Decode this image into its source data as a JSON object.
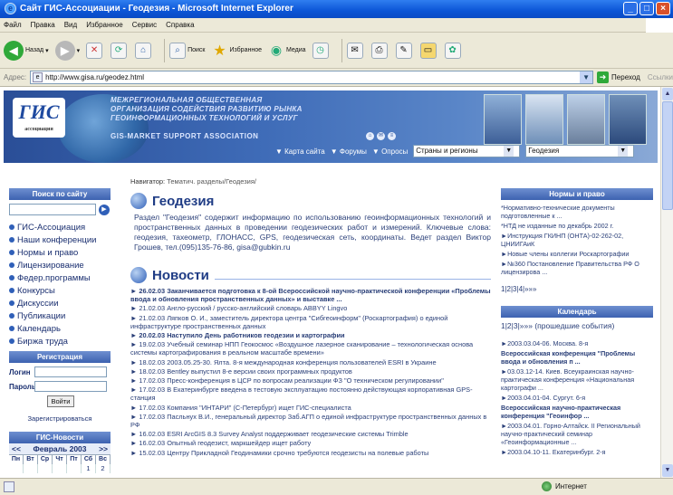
{
  "window": {
    "title": "Сайт ГИС-Ассоциации - Геодезия - Microsoft Internet Explorer"
  },
  "menubar": {
    "items": [
      "Файл",
      "Правка",
      "Вид",
      "Избранное",
      "Сервис",
      "Справка"
    ]
  },
  "toolbar": {
    "back": "Назад",
    "search": "Поиск",
    "favorites": "Избранное",
    "media": "Медиа"
  },
  "address": {
    "label": "Адрес:",
    "url": "http://www.gisa.ru/geodez.html",
    "go": "Переход",
    "links": "Ссылки"
  },
  "banner": {
    "logo": "ГИС",
    "logo_sub": "ассоциация",
    "org_lines": [
      "МЕЖРЕГИОНАЛЬНАЯ ОБЩЕСТВЕННАЯ",
      "ОРГАНИЗАЦИЯ СОДЕЙСТВИЯ РАЗВИТИЮ РЫНКА",
      "ГЕОИНФОРМАЦИОННЫХ ТЕХНОЛОГИЙ И УСЛУГ"
    ],
    "assoc": "GIS-MARKET SUPPORT ASSOCIATION",
    "nav_links": [
      "▼ Карта сайта",
      "▼ Форумы",
      "▼ Опросы"
    ],
    "select1": "Страны и регионы",
    "select2": "Геодезия"
  },
  "left": {
    "search_head": "Поиск по сайту",
    "menu": [
      "ГИС-Ассоциация",
      "Наши конференции",
      "Нормы и право",
      "Лицензирование",
      "Федер.программы",
      "Конкурсы",
      "Дискуссии",
      "Публикации",
      "Календарь",
      "Биржа труда"
    ],
    "reg_head": "Регистрация",
    "login_label": "Логин",
    "password_label": "Пароль",
    "login_button": "Войти",
    "register_link": "Зарегистрироваться",
    "news_head": "ГИС-Новости",
    "cal_prev": "<<",
    "cal_month": "Февраль 2003",
    "cal_next": ">>",
    "cal_days": [
      "Пн",
      "Вт",
      "Ср",
      "Чт",
      "Пт",
      "Сб",
      "Вс"
    ],
    "cal_first_row": [
      "",
      "",
      "",
      "",
      "",
      "1",
      "2"
    ]
  },
  "center": {
    "navigator": "Навигатор:",
    "navigator_path": "Тематич. разделы/Геодезия/",
    "section_title": "Геодезия",
    "intro": "Раздел \"Геодезия\" содержит информацию по использованию геоинформационных технологий и пространственных данных в проведении геодезических работ и измерений. Ключевые слова: геодезия, тахеометр, ГЛОНАСС, GPS, геодезическая сеть, координаты. Ведет раздел Виктор Грошев, тел.(095)135-76-86, gisa@gubkin.ru",
    "news_title": "Новости",
    "news": [
      {
        "text": "► 26.02.03 Заканчивается подготовка к 8-ой Всероссийской научно-практической конференции «Проблемы ввода и обновления пространственных данных» и выставке ...",
        "bold": true
      },
      {
        "text": "► 21.02.03 Англо-русский / русско-английский словарь ABBYY Lingvo",
        "bold": false
      },
      {
        "text": "► 21.02.03 Ляпков О. И., заместитель директора центра \"Сибгеоинформ\" (Роскартография) о единой инфраструктуре пространственных данных",
        "bold": false
      },
      {
        "text": "► 20.02.03 Наступило День работников геодезии и картографии",
        "bold": true
      },
      {
        "text": "► 19.02.03 Учебный семинар НПП Геокосмос «Воздушное лазерное сканирование – технологическая основа системы картографирования в реальном масштабе времени»",
        "bold": false
      },
      {
        "text": "► 18.02.03 2003.05.25-30. Ялта. 8-я международная конференция пользователей ESRI в Украине",
        "bold": false
      },
      {
        "text": "► 18.02.03 Bentley выпустил 8-е версии своих программных продуктов",
        "bold": false
      },
      {
        "text": "► 17.02.03 Пресс-конференция в ЦСР по вопросам реализации ФЗ \"О техническом регулировании\"",
        "bold": false
      },
      {
        "text": "► 17.02.03 В Екатеринбурге введена в тестовую эксплуатацию постоянно действующая корпоративная GPS-станция",
        "bold": false
      },
      {
        "text": "► 17.02.03 Компания \"ИНТАРИ\" (С-Петербург) ищет ГИС-специалиста",
        "bold": false
      },
      {
        "text": "► 17.02.03 Пасльнух В.И., генеральный директор Заб.АГП о единой инфраструктуре пространственных данных в РФ",
        "bold": false
      },
      {
        "text": "► 16.02.03 ESRI ArcGIS 8.3 Survey Analyst поддерживает геодезические системы Trimble",
        "bold": false
      },
      {
        "text": "► 16.02.03 Опытный геодезист, маркшейдер ищет работу",
        "bold": false
      },
      {
        "text": "► 15.02.03 Центру Прикладной Геодинамики срочно требуются геодезисты на полевые работы",
        "bold": false
      }
    ]
  },
  "right": {
    "norms_head": "Нормы и право",
    "norms": [
      {
        "text": "*Нормативно-технические документы подготовленные к ...",
        "bold": false
      },
      {
        "text": "*НТД не изданные по декабрь 2002 г.",
        "bold": false
      },
      {
        "text": "►Инструкция ГКИНП (ОНТА)-02-262-02, ЦНИИГАиК",
        "bold": false
      },
      {
        "text": "►Новые члены коллегии Роскартографии",
        "bold": false
      },
      {
        "text": "►№360 Постановление Правительства РФ О лицензирова ...",
        "bold": false
      }
    ],
    "norms_pager": "1|2|3|4|»»»",
    "cal_head": "Календарь",
    "cal_pager": "1|2|3|»»»   (прошедшие события)",
    "events": [
      {
        "text": "►2003.03.04-06. Москва. 8-я",
        "bold": false
      },
      {
        "text": "Всероссийская конференция \"Проблемы ввода и обновления п ...",
        "bold": true
      },
      {
        "text": "►03.03.12-14. Киев. Всеукраинская научно-практическая конференция «Национальная картографи ...",
        "bold": false
      },
      {
        "text": "►2003.04.01-04. Сургут. 6-я",
        "bold": false
      },
      {
        "text": "Всероссийская научно-практическая конференция \"Геоинфор ...",
        "bold": true
      },
      {
        "text": "►2003.04.01. Горно-Алтайск. II Региональный научно-практический семинар «Геоинформационные ...",
        "bold": false
      },
      {
        "text": "►2003.04.10-11. Екатеринбург. 2-я",
        "bold": false
      }
    ]
  },
  "status": {
    "zone": "Интернет"
  }
}
